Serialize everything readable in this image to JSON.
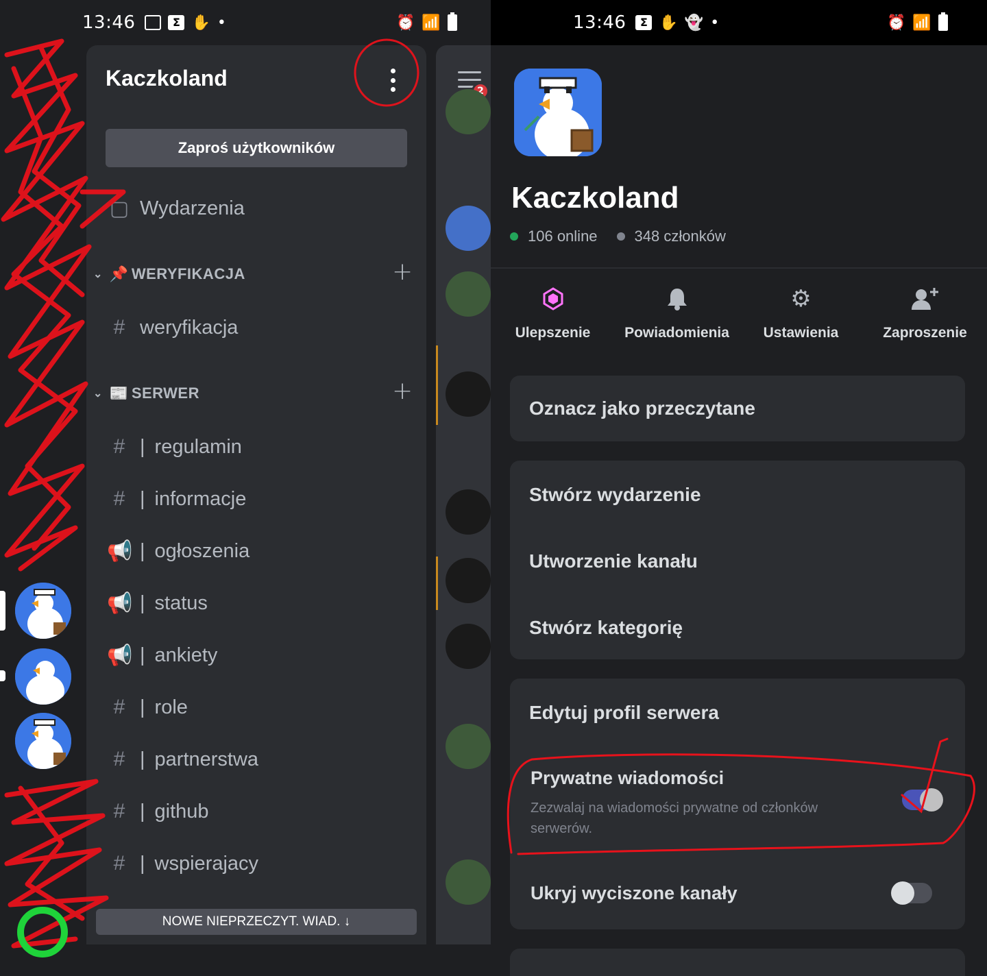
{
  "left": {
    "status": {
      "time": "13:46"
    },
    "server": {
      "name": "Kaczkoland"
    },
    "invite_button": "Zaproś użytkowników",
    "events_label": "Wydarzenia",
    "categories": [
      {
        "name": "WERYFIKACJA",
        "emoji": "📌"
      },
      {
        "name": "SERWER",
        "emoji": "📰"
      }
    ],
    "channels": [
      {
        "name": "weryfikacja",
        "type": "text"
      },
      {
        "name": "regulamin",
        "type": "text"
      },
      {
        "name": "informacje",
        "type": "text"
      },
      {
        "name": "ogłoszenia",
        "type": "announcement"
      },
      {
        "name": "status",
        "type": "announcement"
      },
      {
        "name": "ankiety",
        "type": "announcement"
      },
      {
        "name": "role",
        "type": "text"
      },
      {
        "name": "partnerstwa",
        "type": "text"
      },
      {
        "name": "github",
        "type": "text"
      },
      {
        "name": "wspierajacy",
        "type": "text"
      }
    ],
    "pipe": "|",
    "hash": "#",
    "new_messages_bar": "NOWE NIEPRZECZYT. WIAD. ↓",
    "notification_badge": "2"
  },
  "right": {
    "status": {
      "time": "13:46"
    },
    "server": {
      "name": "Kaczkoland",
      "online": "106 online",
      "members": "348 członków"
    },
    "actions": [
      {
        "label": "Ulepszenie",
        "icon": "boost-icon"
      },
      {
        "label": "Powiadomienia",
        "icon": "bell-icon"
      },
      {
        "label": "Ustawienia",
        "icon": "gear-icon"
      },
      {
        "label": "Zaproszenie",
        "icon": "add-person-icon"
      }
    ],
    "mark_read": "Oznacz jako przeczytane",
    "create_group": [
      "Stwórz wydarzenie",
      "Utworzenie kanału",
      "Stwórz kategorię"
    ],
    "profile_group": {
      "edit_profile": "Edytuj profil serwera",
      "dm_title": "Prywatne wiadomości",
      "dm_desc": "Zezwalaj na wiadomości prywatne od członków serwerów.",
      "dm_enabled": true,
      "hide_muted": "Ukryj wyciszone kanały",
      "hide_muted_enabled": false
    }
  },
  "colors": {
    "online": "#23a55a",
    "offline": "#80848e",
    "boost": "#ff73fa",
    "toggle_on": "#5865f2",
    "toggle_off": "#4e5058",
    "annotation": "#e8121b"
  }
}
